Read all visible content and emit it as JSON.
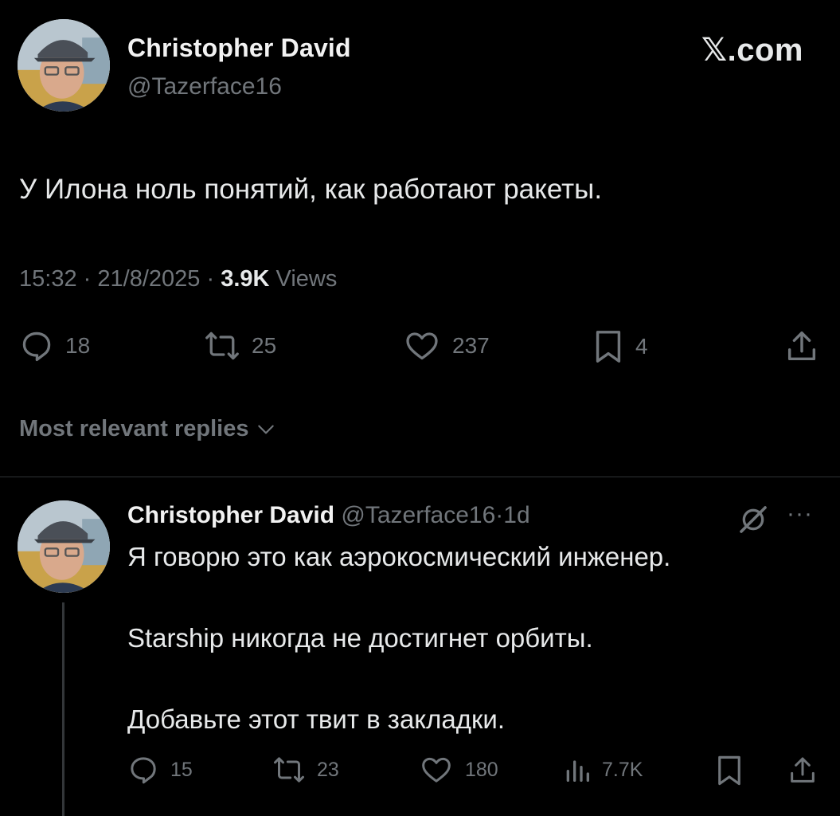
{
  "tweet": {
    "author_name": "Christopher David",
    "handle": "@Tazerface16",
    "brand": "𝕏.com",
    "text": "У Илона ноль понятий, как работают ракеты.",
    "time": "15:32",
    "date": "21/8/2025",
    "separator": "·",
    "views_count": "3.9K",
    "views_label": "Views",
    "stats": {
      "replies": "18",
      "reposts": "25",
      "likes": "237",
      "bookmarks": "4"
    }
  },
  "replies_sort": {
    "label": "Most relevant replies"
  },
  "reply": {
    "author_name": "Christopher David",
    "handle": "@Tazerface16",
    "separator": "·",
    "age": "1d",
    "more": "···",
    "lines": [
      "Я говорю это как аэрокосмический инженер.",
      "Starship никогда не достигнет орбиты.",
      "Добавьте этот твит в закладки."
    ],
    "stats": {
      "replies": "15",
      "reposts": "23",
      "likes": "180",
      "views": "7.7K"
    }
  },
  "colors": {
    "background": "#000000",
    "text": "#e7e9ea",
    "muted": "#71767b",
    "divider": "#2f3336"
  },
  "icons": [
    "avatar-photo",
    "reply-icon",
    "repost-icon",
    "like-icon",
    "bookmark-icon",
    "share-icon",
    "chevron-down-icon",
    "grok-icon",
    "views-icon"
  ]
}
